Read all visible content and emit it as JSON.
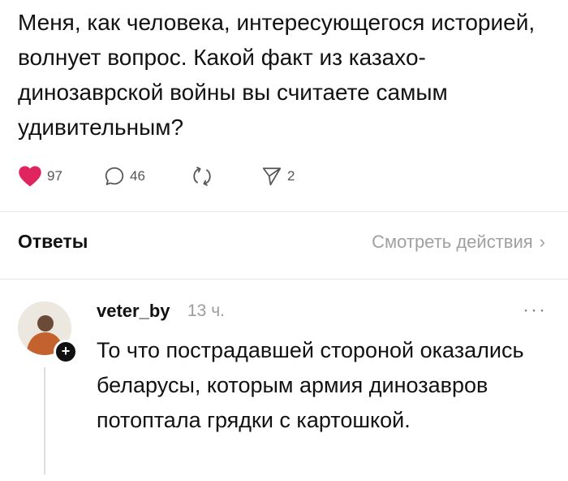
{
  "post": {
    "text": "Меня, как человека, интересующегося историей, волнует вопрос. Какой факт из казахо-динозаврской войны вы считаете самым удивительным?",
    "likes": "97",
    "comments": "46",
    "shares": "2",
    "like_color": "#e0245e"
  },
  "replies_header": {
    "title": "Ответы",
    "view_actions": "Смотреть действия",
    "chevron": "›"
  },
  "reply": {
    "username": "veter_by",
    "time": "13 ч.",
    "more": "···",
    "badge": "+",
    "text": "То что пострадавшей стороной оказались беларусы, которым армия динозавров потоптала грядки с картошкой."
  }
}
